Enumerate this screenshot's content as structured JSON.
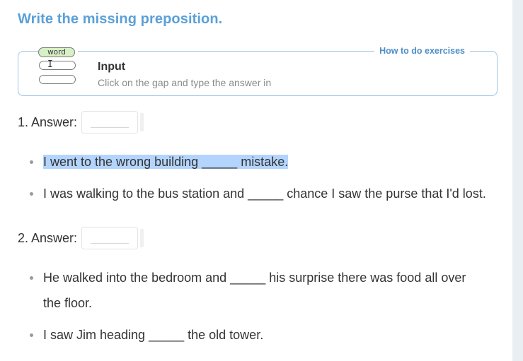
{
  "exercise": {
    "title": "Write the missing preposition."
  },
  "howto": {
    "link_label": "How to do exercises",
    "illustration_word": "word",
    "cursor_glyph": "I",
    "input_title": "Input",
    "input_desc": "Click on the gap and type the answer in"
  },
  "questions": [
    {
      "label": "1. Answer:",
      "answer_value": "",
      "sentences": [
        "I went to the wrong building _____ mistake.",
        "I was walking to the bus station and _____ chance I saw the purse that I'd lost."
      ],
      "selected_sentence_index": 0
    },
    {
      "label": "2. Answer:",
      "answer_value": "",
      "sentences": [
        "He walked into the bedroom and _____ his surprise there was food all over the floor.",
        "I saw Jim heading _____ the old tower."
      ]
    }
  ],
  "colors": {
    "title": "#5aa0d8",
    "box_border": "#9ec4e6",
    "selection": "#b3d4fc",
    "word_pill": "#d7f0c6"
  }
}
